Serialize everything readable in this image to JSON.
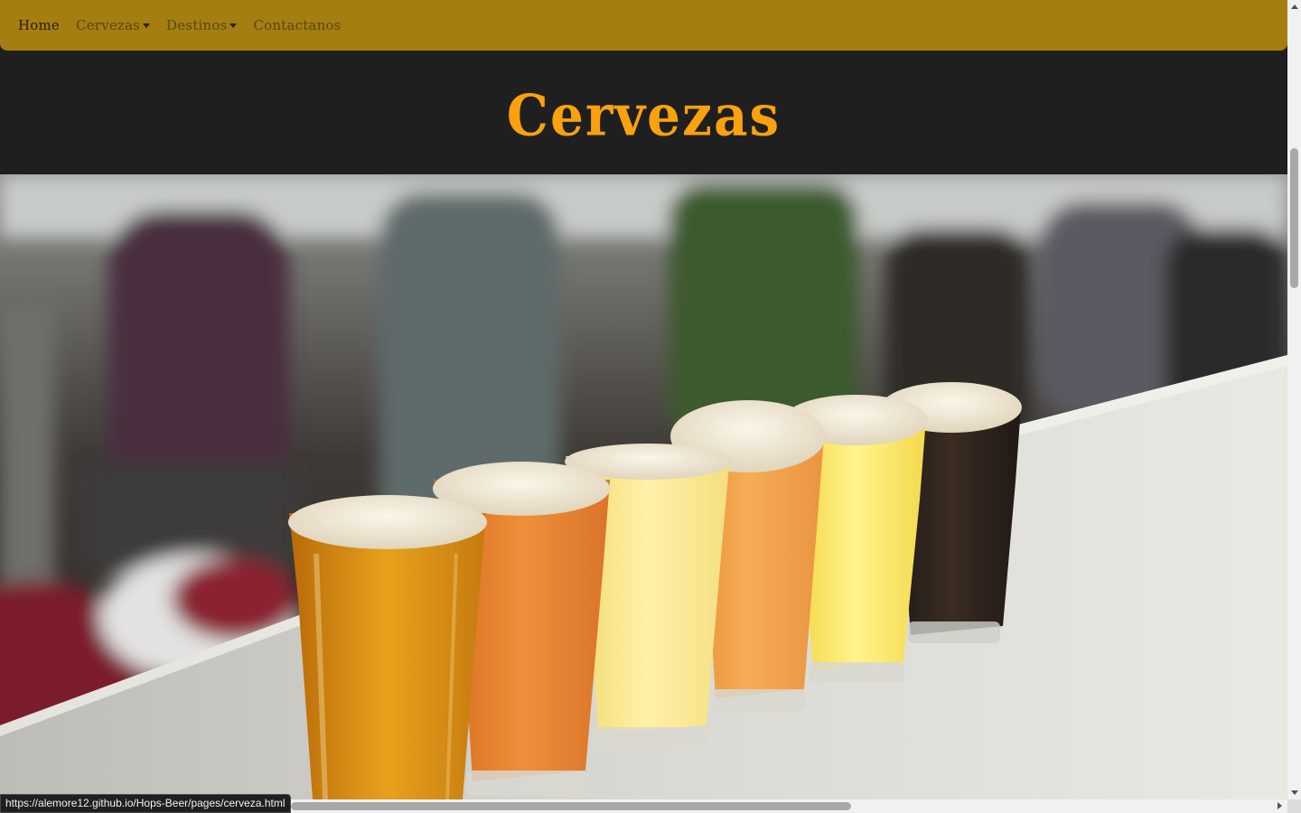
{
  "navbar": {
    "items": [
      {
        "label": "Home",
        "active": true,
        "dropdown": false
      },
      {
        "label": "Cervezas",
        "active": false,
        "dropdown": true
      },
      {
        "label": "Destinos",
        "active": false,
        "dropdown": true
      },
      {
        "label": "Contactanos",
        "active": false,
        "dropdown": false
      }
    ]
  },
  "hero": {
    "title": "Cervezas"
  },
  "status_bar": {
    "url": "https://alemore12.github.io/Hops-Beer/pages/cerveza.html"
  },
  "colors": {
    "navbar_bg": "#a47e10",
    "page_bg": "#1f1f1f",
    "title": "#f9a10e"
  }
}
